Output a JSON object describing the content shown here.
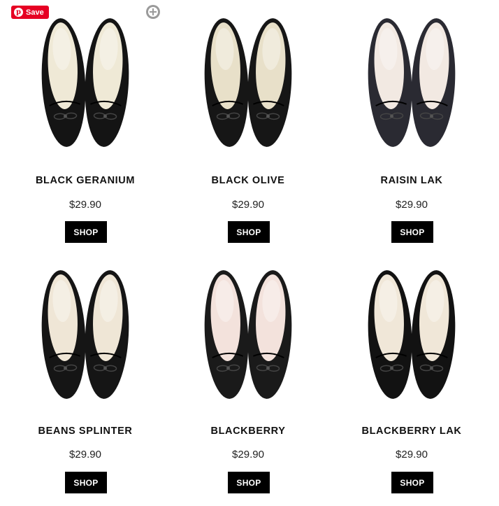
{
  "pinterest": {
    "save_label": "Save",
    "logo_glyph": "p"
  },
  "products": [
    {
      "name": "BLACK GERANIUM",
      "price": "$29.90",
      "button": "SHOP",
      "shoe_color": "#141414",
      "insole_color": "#efe9d6"
    },
    {
      "name": "BLACK OLIVE",
      "price": "$29.90",
      "button": "SHOP",
      "shoe_color": "#161616",
      "insole_color": "#e8e0c9"
    },
    {
      "name": "RAISIN LAK",
      "price": "$29.90",
      "button": "SHOP",
      "shoe_color": "#2a2a32",
      "insole_color": "#f2e9e2"
    },
    {
      "name": "BEANS SPLINTER",
      "price": "$29.90",
      "button": "SHOP",
      "shoe_color": "#151515",
      "insole_color": "#efe6d6"
    },
    {
      "name": "BLACKBERRY",
      "price": "$29.90",
      "button": "SHOP",
      "shoe_color": "#1a1a1a",
      "insole_color": "#f3e2dc"
    },
    {
      "name": "BLACKBERRY LAK",
      "price": "$29.90",
      "button": "SHOP",
      "shoe_color": "#121212",
      "insole_color": "#f0e7d8"
    }
  ]
}
